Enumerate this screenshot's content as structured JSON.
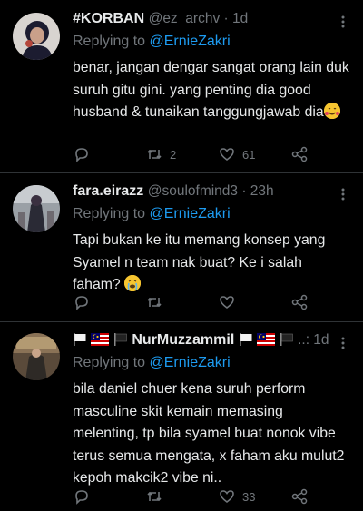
{
  "tweets": [
    {
      "name": "#KORBAN",
      "handle": "@ez_archv · 1d",
      "reply_prefix": "Replying to ",
      "reply_to": "@ErnieZakri",
      "text": "benar, jangan dengar sangat orang lain duk suruh gitu gini. yang penting dia good husband & tunaikan tanggungjawab dia",
      "emoji": "smiling-face-with-hearts",
      "retweets": "2",
      "likes": "61"
    },
    {
      "name": "fara.eirazz",
      "handle": "@soulofmind3 · 23h",
      "reply_prefix": "Replying to ",
      "reply_to": "@ErnieZakri",
      "text": "Tapi bukan ke itu memang konsep yang Syamel n team nak buat? Ke i salah faham?",
      "emoji": "crying-face",
      "retweets": "",
      "likes": ""
    },
    {
      "name": "NurMuzzammil",
      "handle": "..: 1d",
      "reply_prefix": "Replying to ",
      "reply_to": "@ErnieZakri",
      "text": "bila daniel chuer kena suruh perform masculine skit kemain memasing melenting, tp bila syamel buat nonok vibe terus semua mengata, x faham aku mulut2 kepoh makcik2 vibe ni..",
      "retweets": "",
      "likes": "33"
    }
  ],
  "colors": {
    "background": "#000000",
    "text": "#e7e9ea",
    "secondary": "#71767b",
    "link": "#1d9bf0",
    "divider": "#2f3336"
  }
}
